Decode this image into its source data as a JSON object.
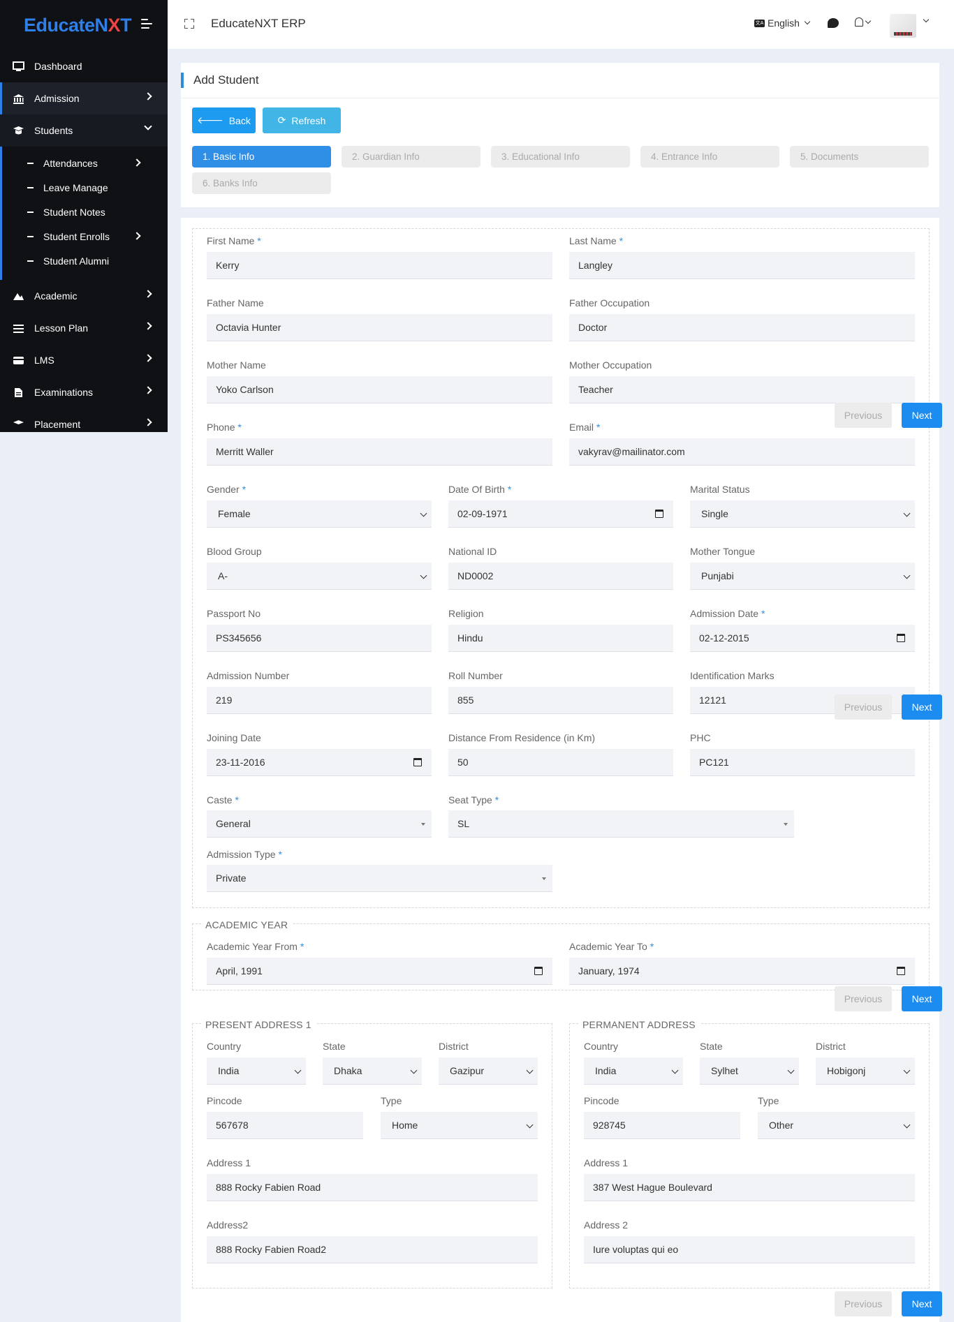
{
  "brand": {
    "name_prefix": "EducateN",
    "name_x": "X",
    "name_suffix": "T"
  },
  "sidebar": {
    "items": [
      {
        "label": "Dashboard"
      },
      {
        "label": "Admission"
      },
      {
        "label": "Students"
      },
      {
        "label": "Academic"
      },
      {
        "label": "Lesson Plan"
      },
      {
        "label": "LMS"
      },
      {
        "label": "Examinations"
      },
      {
        "label": "Placement"
      }
    ],
    "sub_items": [
      {
        "label": "Attendances"
      },
      {
        "label": "Leave Manage"
      },
      {
        "label": "Student Notes"
      },
      {
        "label": "Student Enrolls"
      },
      {
        "label": "Student Alumni"
      }
    ]
  },
  "topbar": {
    "title": "EducateNXT ERP",
    "language": "English",
    "lang_icon": "文A"
  },
  "page": {
    "title": "Add Student",
    "back_label": "Back",
    "refresh_label": "Refresh",
    "tabs": [
      {
        "label": "1. Basic Info"
      },
      {
        "label": "2. Guardian Info"
      },
      {
        "label": "3. Educational Info"
      },
      {
        "label": "4. Entrance Info"
      },
      {
        "label": "5. Documents"
      },
      {
        "label": "6. Banks Info"
      }
    ],
    "prev_label": "Previous",
    "next_label": "Next"
  },
  "form": {
    "first_name": {
      "label": "First Name",
      "value": "Kerry"
    },
    "last_name": {
      "label": "Last Name",
      "value": "Langley"
    },
    "father_name": {
      "label": "Father Name",
      "value": "Octavia Hunter"
    },
    "father_occupation": {
      "label": "Father Occupation",
      "value": "Doctor"
    },
    "mother_name": {
      "label": "Mother Name",
      "value": "Yoko Carlson"
    },
    "mother_occupation": {
      "label": "Mother Occupation",
      "value": "Teacher"
    },
    "phone": {
      "label": "Phone",
      "value": "Merritt Waller"
    },
    "email": {
      "label": "Email",
      "value": "vakyrav@mailinator.com"
    },
    "gender": {
      "label": "Gender",
      "value": "Female"
    },
    "dob": {
      "label": "Date Of Birth",
      "value": "02-09-1971"
    },
    "marital_status": {
      "label": "Marital Status",
      "value": "Single"
    },
    "blood_group": {
      "label": "Blood Group",
      "value": "A-"
    },
    "national_id": {
      "label": "National ID",
      "value": "ND0002"
    },
    "mother_tongue": {
      "label": "Mother Tongue",
      "value": "Punjabi"
    },
    "passport_no": {
      "label": "Passport No",
      "value": "PS345656"
    },
    "religion": {
      "label": "Religion",
      "value": "Hindu"
    },
    "admission_date": {
      "label": "Admission Date",
      "value": "02-12-2015"
    },
    "admission_number": {
      "label": "Admission Number",
      "value": "219"
    },
    "roll_number": {
      "label": "Roll Number",
      "value": "855"
    },
    "identification_marks": {
      "label": "Identification Marks",
      "value": "12121"
    },
    "joining_date": {
      "label": "Joining Date",
      "value": "23-11-2016"
    },
    "distance": {
      "label": "Distance From Residence (in Km)",
      "value": "50"
    },
    "phc": {
      "label": "PHC",
      "value": "PC121"
    },
    "caste": {
      "label": "Caste",
      "value": "General"
    },
    "seat_type": {
      "label": "Seat Type",
      "value": "SL"
    },
    "admission_type": {
      "label": "Admission Type",
      "value": "Private"
    }
  },
  "academic_year": {
    "legend": "ACADEMIC YEAR",
    "from": {
      "label": "Academic Year From",
      "value": "April, 1991"
    },
    "to": {
      "label": "Academic Year To",
      "value": "January, 1974"
    }
  },
  "present_address": {
    "legend": "PRESENT ADDRESS 1",
    "country": {
      "label": "Country",
      "value": "India"
    },
    "state": {
      "label": "State",
      "value": "Dhaka"
    },
    "district": {
      "label": "District",
      "value": "Gazipur"
    },
    "pincode": {
      "label": "Pincode",
      "value": "567678"
    },
    "type": {
      "label": "Type",
      "value": "Home"
    },
    "address1": {
      "label": "Address 1",
      "value": "888 Rocky Fabien Road"
    },
    "address2": {
      "label": "Address2",
      "value": "888 Rocky Fabien Road2"
    }
  },
  "permanent_address": {
    "legend": "PERMANENT ADDRESS",
    "country": {
      "label": "Country",
      "value": "India"
    },
    "state": {
      "label": "State",
      "value": "Sylhet"
    },
    "district": {
      "label": "District",
      "value": "Hobigonj"
    },
    "pincode": {
      "label": "Pincode",
      "value": "928745"
    },
    "type": {
      "label": "Type",
      "value": "Other"
    },
    "address1": {
      "label": "Address 1",
      "value": "387 West Hague Boulevard"
    },
    "address2": {
      "label": "Address 2",
      "value": "Iure voluptas qui eo"
    }
  },
  "colors": {
    "accent": "#2f8ee6",
    "sidebar_bg": "#0f1115",
    "next_button": "#1d8cf0",
    "brand_blue": "#2f7fe8"
  }
}
